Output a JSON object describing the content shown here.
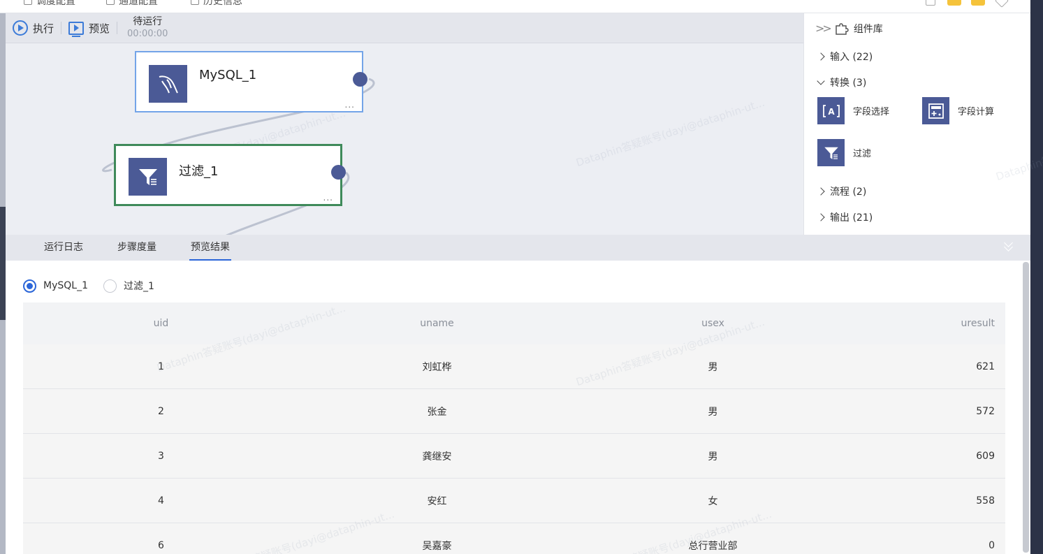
{
  "top_strip": {
    "tabs": [
      "调度配置",
      "通道配置",
      "历史信息"
    ]
  },
  "toolbar": {
    "run_label": "执行",
    "preview_label": "预览",
    "status_label": "待运行",
    "status_time": "00:00:00"
  },
  "nodes": [
    {
      "title": "MySQL_1",
      "icon": "mysql-dolphin-icon",
      "more": "..."
    },
    {
      "title": "过滤_1",
      "icon": "filter-icon",
      "more": "..."
    }
  ],
  "component_library": {
    "title": "组件库",
    "groups": [
      {
        "label": "输入 (22)",
        "expanded": false
      },
      {
        "label": "转换 (3)",
        "expanded": true
      },
      {
        "label": "流程 (2)",
        "expanded": false
      },
      {
        "label": "输出 (21)",
        "expanded": false
      }
    ],
    "transform_items": [
      {
        "label": "字段选择",
        "icon": "field-select-icon"
      },
      {
        "label": "字段计算",
        "icon": "field-calc-icon"
      },
      {
        "label": "过滤",
        "icon": "filter-icon"
      }
    ]
  },
  "bottom_panel": {
    "tabs": [
      "运行日志",
      "步骤度量",
      "预览结果"
    ],
    "active_tab": "预览结果",
    "radio_options": [
      "MySQL_1",
      "过滤_1"
    ],
    "selected_option": "MySQL_1",
    "table": {
      "columns": [
        "uid",
        "uname",
        "usex",
        "uresult"
      ],
      "rows": [
        [
          "1",
          "刘虹桦",
          "男",
          "621"
        ],
        [
          "2",
          "张金",
          "男",
          "572"
        ],
        [
          "3",
          "龚继安",
          "男",
          "609"
        ],
        [
          "4",
          "安红",
          "女",
          "558"
        ],
        [
          "6",
          "吴嘉豪",
          "总行营业部",
          "0"
        ]
      ]
    }
  },
  "watermark": "Dataphin答疑账号(dayi@dataphin-ut...",
  "colors": {
    "accent": "#2c66d8",
    "node_icon_bg": "#4b5a96",
    "node1_border": "#73a4e8",
    "node2_border": "#3f8a5a"
  }
}
